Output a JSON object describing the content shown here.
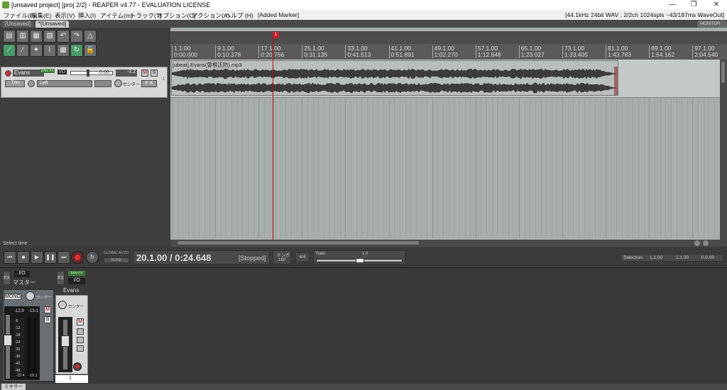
{
  "window": {
    "title": "[unsaved project] [proj 2/2] - REAPER v4.77 - EVALUATION LICENSE",
    "controls": {
      "minimize": "—",
      "maximize": "❐",
      "close": "✕"
    }
  },
  "menu": {
    "items": [
      "ファイル(F)",
      "編集(E)",
      "表示(V)",
      "挿入(I)",
      "アイテム(m)",
      "トラック(T)",
      "オプション(O)",
      "アクション(A)",
      "ヘルプ (H)",
      "[Added Marker]"
    ],
    "status_info": "[44.1kHz 24bit WAV : 2/2ch 1024spls ~43/187ms WaveOut]"
  },
  "project_tabs": [
    {
      "label": "[Unsaved]",
      "active": false
    },
    {
      "label": "*[Unsaved]",
      "active": true
    }
  ],
  "topright_label": "MONITOR FX",
  "track": {
    "number": "1",
    "name": "Evans",
    "fx_label": "ENV FX",
    "io_label": "I/O",
    "volume_value": "0.00",
    "pan_value": "-3.2",
    "m": "M",
    "s": "S",
    "trim_label": "Trim",
    "input_label": "Left",
    "pan_label": "センター",
    "fx": "F X"
  },
  "tcp_status": "Select time",
  "ruler": {
    "bars": [
      "1.1.00",
      "9.1.00",
      "17.1.00",
      "25.1.00",
      "33.1.00",
      "41.1.00",
      "49.1.00",
      "57.1.00",
      "65.1.00",
      "73.1.00",
      "81.1.00",
      "89.1.00",
      "97.1.00"
    ],
    "times": [
      "0:00.000",
      "0:10.378",
      "0:20.756",
      "0:31.135",
      "0:41.513",
      "0:51.891",
      "1:02.270",
      "1:12.648",
      "1:23.027",
      "1:33.405",
      "1:43.783",
      "1:54.162",
      "2:04.540"
    ]
  },
  "marker_label": "1",
  "item": {
    "label": "[ubeat] Evans(曽根正防).mp3",
    "playhead_position_seconds": 24.648
  },
  "transport": {
    "position": "20.1.00 / 0:24.648",
    "state": "[Stopped]",
    "global_auto": "GLOBAL AUTO",
    "global_auto_sub": "NONE",
    "tempo_label": "テンポ",
    "tempo_value": "180",
    "time_sig": "4/4",
    "rate_label": "Rate:",
    "rate_value": "1.0",
    "selection_label": "Selection:",
    "selection_start": "1.1.00",
    "selection_end": "1.1.00",
    "selection_length": "0.0.00",
    "buttons": [
      "⏮",
      "■",
      "▶",
      "❚❚",
      "⏭"
    ]
  },
  "mixer": {
    "master": {
      "name": "マスター",
      "io": "I/O",
      "fx": "FX",
      "mono": "MONO",
      "pan": "センター",
      "peak_l": "-12.9",
      "peak_r": "-13.1",
      "vol_l": "-10.4",
      "vol_r": "-10.1",
      "m": "M",
      "s": "S",
      "scale": [
        "-6",
        "-12",
        "-18",
        "-24",
        "-30",
        "-36",
        "-42",
        "-48",
        "-54"
      ]
    },
    "track": {
      "name": "Evans",
      "io": "I/O",
      "fx": "FX",
      "fx_env": "ENV FX",
      "pan": "センター",
      "m": "M",
      "number": "1"
    },
    "tab_label": "ミキサー"
  }
}
